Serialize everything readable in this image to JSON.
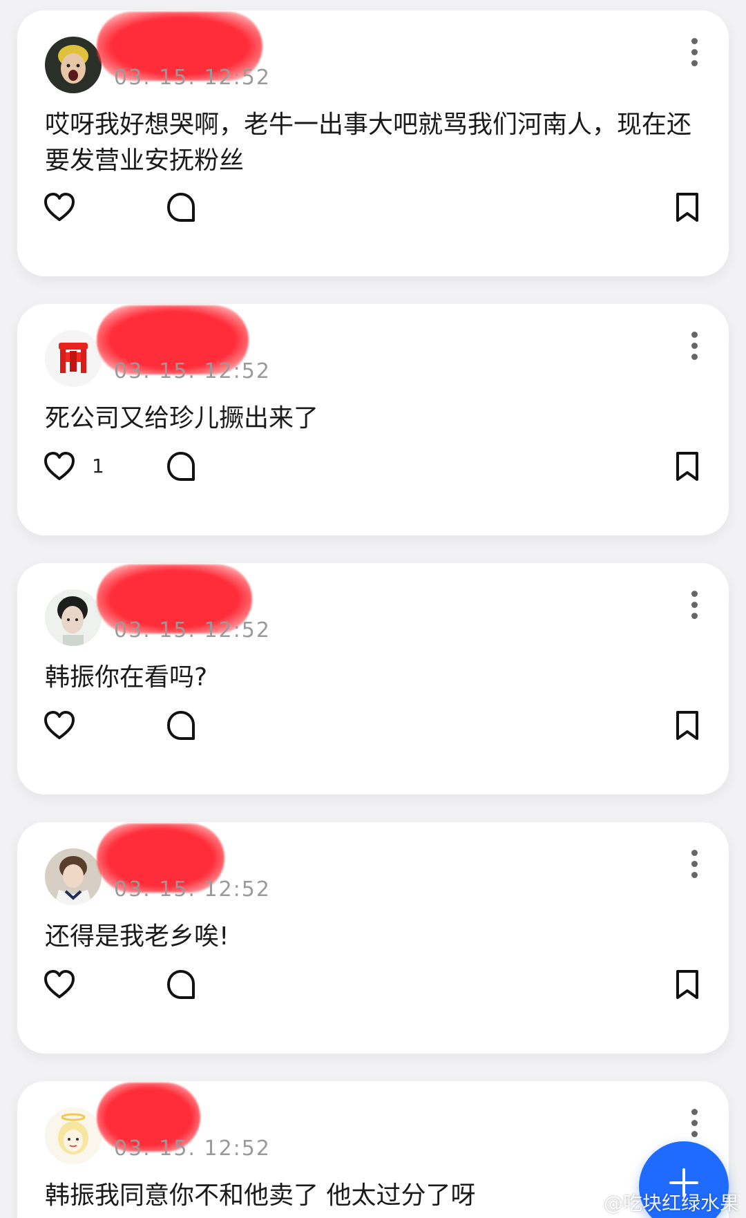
{
  "posts": [
    {
      "timestamp": "03. 15. 12:52",
      "content": "哎呀我好想哭啊，老牛一出事大吧就骂我们河南人，现在还要发营业安抚粉丝",
      "like_count": "",
      "avatar_icon": "avatar-photo-screaming-face"
    },
    {
      "timestamp": "03. 15. 12:52",
      "content": "死公司又给珍儿撅出来了",
      "like_count": "1",
      "avatar_icon": "avatar-red-stool"
    },
    {
      "timestamp": "03. 15. 12:52",
      "content": "韩振你在看吗?",
      "like_count": "",
      "avatar_icon": "avatar-photo-person"
    },
    {
      "timestamp": "03. 15. 12:52",
      "content": "还得是我老乡唉!",
      "like_count": "",
      "avatar_icon": "avatar-photo-person-uniform"
    },
    {
      "timestamp": "03. 15. 12:52",
      "content": "韩振我同意你不和他卖了 他太过分了呀",
      "like_count": "",
      "avatar_icon": "avatar-cartoon-angel"
    }
  ],
  "icons": {
    "like": "heart-icon",
    "comment": "comment-bubble-icon",
    "bookmark": "bookmark-icon",
    "more": "more-vertical-icon",
    "fab": "plus-icon"
  },
  "colors": {
    "background": "#f2f2f4",
    "card": "#ffffff",
    "fab": "#1f6bff",
    "redaction": "#ff2d3a",
    "timestamp": "#9a9a9a"
  },
  "watermark": {
    "text": "@吃块红绿水果"
  }
}
